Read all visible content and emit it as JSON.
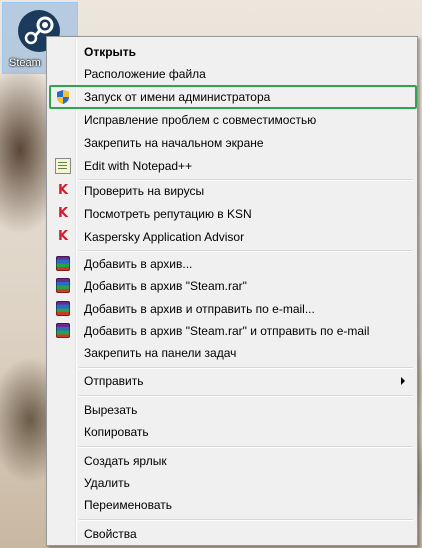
{
  "desktop": {
    "icon_caption": "Steam"
  },
  "menu": {
    "items": {
      "open": "Открыть",
      "file_location": "Расположение файла",
      "run_as_admin": "Запуск от имени администратора",
      "compat": "Исправление проблем с совместимостью",
      "pin_start": "Закрепить на начальном экране",
      "notepad": "Edit with Notepad++",
      "scan": "Проверить на вирусы",
      "ksn": "Посмотреть репутацию в KSN",
      "kav_advisor": "Kaspersky Application Advisor",
      "archive": "Добавить в архив...",
      "archive_named": "Добавить в архив \"Steam.rar\"",
      "archive_email": "Добавить в архив и отправить по e-mail...",
      "archive_named_email": "Добавить в архив \"Steam.rar\" и отправить по e-mail",
      "pin_taskbar": "Закрепить на панели задач",
      "send_to": "Отправить",
      "cut": "Вырезать",
      "copy": "Копировать",
      "shortcut": "Создать ярлык",
      "delete": "Удалить",
      "rename": "Переименовать",
      "properties": "Свойства"
    },
    "highlight_color": "#2ea44f"
  },
  "icons": {
    "steam": "steam-logo-icon",
    "uac": "uac-shield-icon",
    "notepad": "notepad-plus-plus-icon",
    "kaspersky": "kaspersky-k-icon",
    "winrar": "winrar-books-icon",
    "submenu": "submenu-arrow-icon"
  }
}
